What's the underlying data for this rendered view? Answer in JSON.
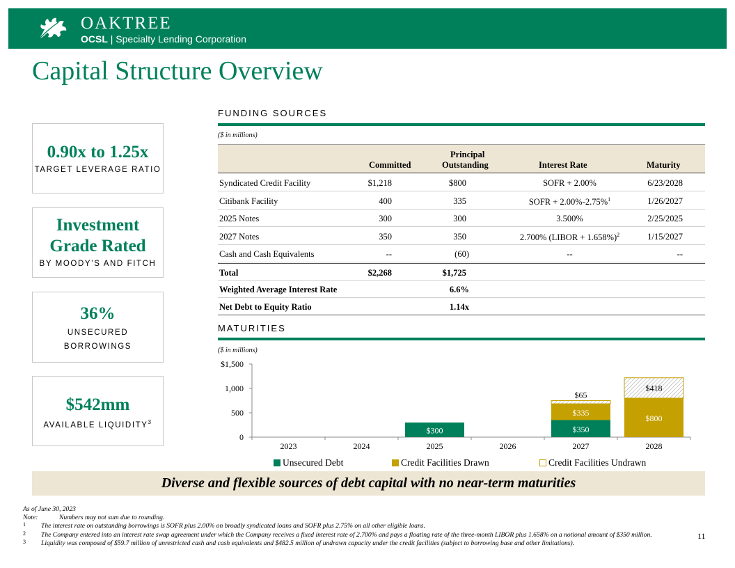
{
  "header": {
    "brand": "OAKTREE",
    "ticker": "OCSL",
    "company": "| Specialty Lending Corporation",
    "color": "#00805a"
  },
  "page_title": "Capital Structure Overview",
  "kpis": [
    {
      "value": "0.90x to 1.25x",
      "label": "TARGET LEVERAGE RATIO"
    },
    {
      "value_line1": "Investment",
      "value_line2": "Grade Rated",
      "label": "BY MOODY’S AND FITCH"
    },
    {
      "value": "36%",
      "label_line1": "UNSECURED",
      "label_line2": "BORROWINGS"
    },
    {
      "value": "$542mm",
      "label": "AVAILABLE LIQUIDITY",
      "label_sup": "3"
    }
  ],
  "funding": {
    "title": "FUNDING SOURCES",
    "units": "($ in millions)",
    "headers": {
      "committed": "Committed",
      "principal_l1": "Principal",
      "principal_l2": "Outstanding",
      "rate": "Interest Rate",
      "maturity": "Maturity"
    },
    "rows": [
      {
        "name": "Syndicated Credit Facility",
        "committed": "$1,218",
        "outstanding": "$800",
        "rate": "SOFR + 2.00%",
        "rate_sup": "",
        "maturity": "6/23/2028"
      },
      {
        "name": "Citibank Facility",
        "committed": "400",
        "outstanding": "335",
        "rate": "SOFR + 2.00%-2.75%",
        "rate_sup": "1",
        "maturity": "1/26/2027"
      },
      {
        "name": "2025 Notes",
        "committed": "300",
        "outstanding": "300",
        "rate": "3.500%",
        "rate_sup": "",
        "maturity": "2/25/2025"
      },
      {
        "name": "2027 Notes",
        "committed": "350",
        "outstanding": "350",
        "rate": "2.700% (LIBOR + 1.658%)",
        "rate_sup": "2",
        "maturity": "1/15/2027"
      },
      {
        "name": "Cash and Cash Equivalents",
        "committed": "--",
        "outstanding": "(60)",
        "rate": "--",
        "rate_sup": "",
        "maturity": "--"
      }
    ],
    "total": {
      "name": "Total",
      "committed": "$2,268",
      "outstanding": "$1,725"
    },
    "wair": {
      "name": "Weighted Average Interest Rate",
      "value": "6.6%"
    },
    "ndte": {
      "name": "Net Debt to Equity Ratio",
      "value": "1.14x"
    }
  },
  "maturities": {
    "title": "MATURITIES",
    "units": "($ in millions)"
  },
  "chart_data": {
    "type": "bar",
    "stacked": true,
    "categories": [
      "2023",
      "2024",
      "2025",
      "2026",
      "2027",
      "2028"
    ],
    "series": [
      {
        "name": "Unsecured Debt",
        "values": [
          0,
          0,
          300,
          0,
          350,
          0
        ],
        "color": "#00805a"
      },
      {
        "name": "Credit Facilities Drawn",
        "values": [
          0,
          0,
          0,
          0,
          335,
          800
        ],
        "color": "#c4a000"
      },
      {
        "name": "Credit Facilities Undrawn",
        "values": [
          0,
          0,
          0,
          0,
          65,
          418
        ],
        "color": "#ffffff"
      }
    ],
    "data_labels": {
      "Unsecured Debt": [
        "",
        "",
        "$300",
        "",
        "$350",
        ""
      ],
      "Credit Facilities Drawn": [
        "",
        "",
        "",
        "",
        "$335",
        "$800"
      ],
      "Credit Facilities Undrawn": [
        "",
        "",
        "",
        "",
        "$65",
        "$418"
      ]
    },
    "y_ticks": [
      "0",
      "500",
      "1,000",
      "$1,500"
    ],
    "y_tick_values": [
      0,
      500,
      1000,
      1500
    ],
    "ylim": [
      0,
      1500
    ],
    "legend_position": "bottom",
    "grid": false
  },
  "banner": "Diverse and flexible sources of debt capital with no near-term maturities",
  "footnotes": {
    "asof": "As of June 30, 2023",
    "note_label": "Note:",
    "note": "Numbers may not sum due to rounding.",
    "items": [
      {
        "mark": "1",
        "text": "The interest rate on outstanding borrowings is SOFR plus 2.00% on broadly syndicated loans and SOFR plus 2.75% on all other eligible loans."
      },
      {
        "mark": "2",
        "text": "The Company entered into an interest rate swap agreement under which the Company receives a fixed interest rate of 2.700% and pays a floating rate of the three-month LIBOR plus 1.658% on a notional amount of $350 million."
      },
      {
        "mark": "3",
        "text": "Liquidity was composed of $59.7 million of unrestricted cash and cash equivalents and $482.5 million of undrawn capacity under the credit facilities (subject to borrowing base and other limitations)."
      }
    ]
  },
  "page_number": "11"
}
